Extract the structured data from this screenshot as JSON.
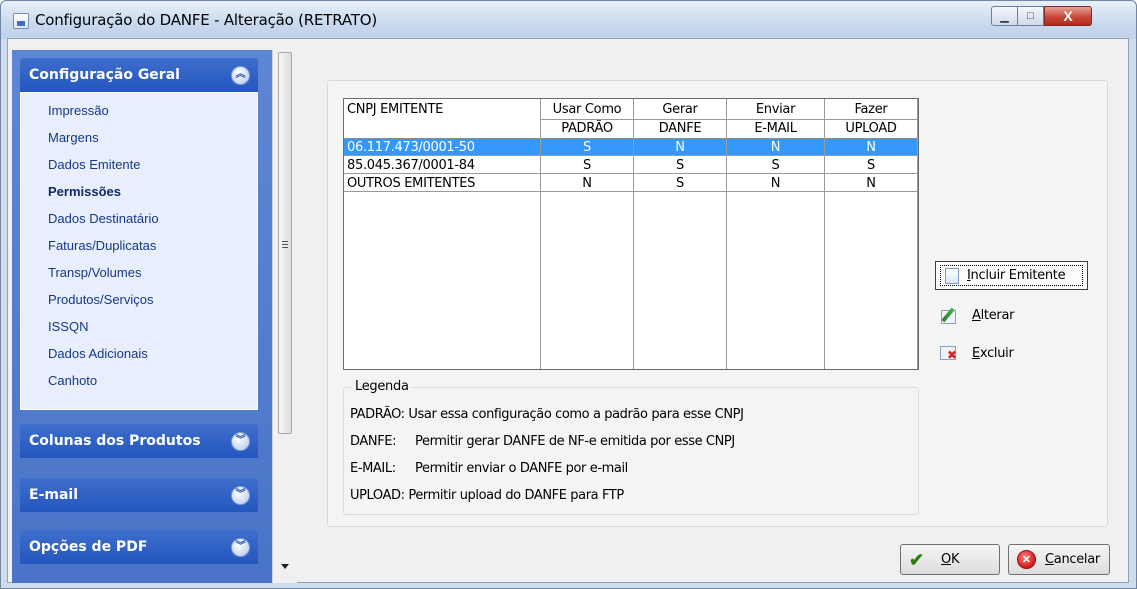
{
  "window": {
    "title": "Configuração do DANFE - Alteração  (RETRATO)",
    "minimize_glyph": "▁",
    "maximize_glyph": "□",
    "close_glyph": "X"
  },
  "sidebar": {
    "groups": [
      {
        "label": "Configuração Geral",
        "expanded": true,
        "chevron": "︽",
        "items": [
          {
            "label": "Impressão"
          },
          {
            "label": "Margens"
          },
          {
            "label": "Dados Emitente"
          },
          {
            "label": "Permissões",
            "active": true
          },
          {
            "label": "Dados Destinatário"
          },
          {
            "label": "Faturas/Duplicatas"
          },
          {
            "label": "Transp/Volumes"
          },
          {
            "label": "Produtos/Serviços"
          },
          {
            "label": "ISSQN"
          },
          {
            "label": "Dados Adicionais"
          },
          {
            "label": "Canhoto"
          }
        ]
      },
      {
        "label": "Colunas dos Produtos",
        "expanded": false,
        "chevron": "︾"
      },
      {
        "label": "E-mail",
        "expanded": false,
        "chevron": "︾"
      },
      {
        "label": "Opções de PDF",
        "expanded": false,
        "chevron": "︾"
      }
    ]
  },
  "grid": {
    "columns": [
      {
        "line1": "CNPJ EMITENTE",
        "line2": ""
      },
      {
        "line1": "Usar Como",
        "line2": "PADRÃO"
      },
      {
        "line1": "Gerar",
        "line2": "DANFE"
      },
      {
        "line1": "Enviar",
        "line2": "E-MAIL"
      },
      {
        "line1": "Fazer",
        "line2": "UPLOAD"
      }
    ],
    "rows": [
      {
        "cnpj": "06.117.473/0001-50",
        "padrao": "S",
        "danfe": "N",
        "email": "N",
        "upload": "N",
        "selected": true
      },
      {
        "cnpj": "85.045.367/0001-84",
        "padrao": "S",
        "danfe": "S",
        "email": "S",
        "upload": "S",
        "selected": false
      },
      {
        "cnpj": "OUTROS EMITENTES",
        "padrao": "N",
        "danfe": "S",
        "email": "N",
        "upload": "N",
        "selected": false
      }
    ]
  },
  "legend": {
    "title": "Legenda",
    "lines": [
      {
        "key": "PADRÃO:",
        "text": "Usar essa configuração como a padrão para esse CNPJ"
      },
      {
        "key": "DANFE:",
        "text": "Permitir gerar DANFE de NF-e emitida por esse CNPJ"
      },
      {
        "key": "E-MAIL:",
        "text": "Permitir enviar o DANFE por e-mail"
      },
      {
        "key": "UPLOAD:",
        "text": "Permitir upload do DANFE para FTP"
      }
    ]
  },
  "actions": {
    "incluir": {
      "first": "I",
      "rest": "ncluir Emitente"
    },
    "alterar": {
      "first": "A",
      "rest": "lterar"
    },
    "excluir": {
      "first": "E",
      "rest": "xcluir"
    }
  },
  "footer": {
    "ok": {
      "first": "O",
      "rest": "K",
      "icon": "✔"
    },
    "cancel": {
      "first": "C",
      "rest": "ancelar",
      "icon": "✕"
    }
  }
}
